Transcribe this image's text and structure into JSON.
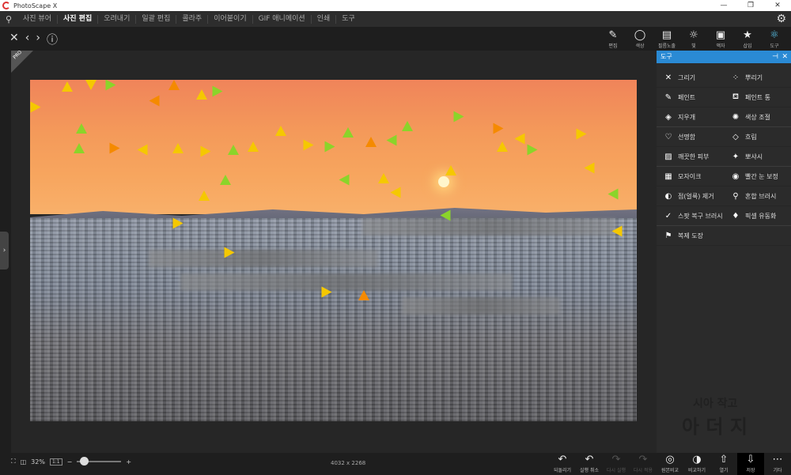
{
  "app": {
    "title": "PhotoScape X"
  },
  "window_controls": {
    "minimize": "—",
    "maximize": "❐",
    "close": "✕"
  },
  "menu": {
    "items": [
      "사진 뷰어",
      "사진 편집",
      "오려내기",
      "일괄 편집",
      "콜라주",
      "이어붙이기",
      "GIF 애니메이션",
      "인쇄",
      "도구"
    ],
    "active": "사진 편집"
  },
  "toolbar": {
    "tools": [
      {
        "label": "편집",
        "icon": "edit-icon"
      },
      {
        "label": "색상",
        "icon": "color-icon"
      },
      {
        "label": "필름노출",
        "icon": "film-icon"
      },
      {
        "label": "빛",
        "icon": "light-icon"
      },
      {
        "label": "액자",
        "icon": "frame-icon"
      },
      {
        "label": "삽입",
        "icon": "insert-icon"
      },
      {
        "label": "도구",
        "icon": "tools-icon"
      }
    ]
  },
  "panel": {
    "title": "도구",
    "items": [
      [
        "그리기",
        "뿌리기"
      ],
      [
        "페인트",
        "페인트 통"
      ],
      [
        "지우개",
        "색상 조절"
      ],
      [
        "선명함",
        "흐림"
      ],
      [
        "깨끗한 피부",
        "뽀샤시"
      ],
      [
        "모자이크",
        "빨간 눈 보정"
      ],
      [
        "점(얼룩) 제거",
        "혼합 브러시"
      ],
      [
        "스팟 복구 브러시",
        "픽셀 유동화"
      ],
      [
        "복제 도장",
        ""
      ]
    ],
    "icons": [
      [
        "draw-icon",
        "scatter-icon"
      ],
      [
        "paint-brush-icon",
        "paint-bucket-icon"
      ],
      [
        "eraser-icon",
        "color-adjust-icon"
      ],
      [
        "sharpen-icon",
        "blur-icon"
      ],
      [
        "clean-skin-icon",
        "soft-glow-icon"
      ],
      [
        "mosaic-icon",
        "red-eye-icon"
      ],
      [
        "spot-remove-icon",
        "mix-brush-icon"
      ],
      [
        "spot-heal-brush-icon",
        "liquify-icon"
      ],
      [
        "clone-stamp-icon",
        ""
      ]
    ]
  },
  "bottom": {
    "zoom_percent": "32%",
    "one_to_one": "1:1",
    "image_size": "4032 x 2268",
    "actions": [
      {
        "label": "되돌리기",
        "icon": "revert-icon",
        "enabled": true
      },
      {
        "label": "실행 취소",
        "icon": "undo-icon",
        "enabled": true
      },
      {
        "label": "다시 실행",
        "icon": "redo-icon",
        "enabled": false
      },
      {
        "label": "다시 적용",
        "icon": "redo-all-icon",
        "enabled": false
      },
      {
        "label": "원본비교",
        "icon": "compare-original-icon",
        "enabled": true
      },
      {
        "label": "비교하기",
        "icon": "compare-icon",
        "enabled": true
      },
      {
        "label": "열기",
        "icon": "open-icon",
        "enabled": true
      },
      {
        "label": "저장",
        "icon": "save-icon",
        "enabled": true
      },
      {
        "label": "기타",
        "icon": "more-icon",
        "enabled": true
      }
    ]
  },
  "badge": {
    "pro": "PRO"
  },
  "watermark": {
    "line1": "시아 작고",
    "line2": "아 더 지"
  },
  "colors": {
    "accent": "#2a8ad4",
    "tool_active": "#5ac8f0"
  }
}
